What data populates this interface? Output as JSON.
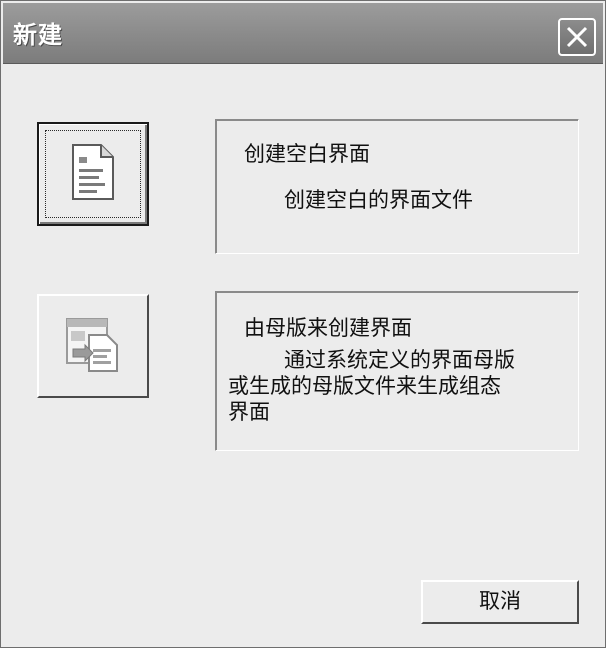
{
  "window": {
    "title": "新建"
  },
  "options": [
    {
      "title": "创建空白界面",
      "description": "创建空白的界面文件",
      "icon": "blank-document-icon"
    },
    {
      "title": "由母版来创建界面",
      "description_lines": [
        "通过系统定义的界面母版",
        "或生成的母版文件来生成组态",
        "界面"
      ],
      "icon": "template-document-icon"
    }
  ],
  "buttons": {
    "cancel_label": "取消"
  }
}
